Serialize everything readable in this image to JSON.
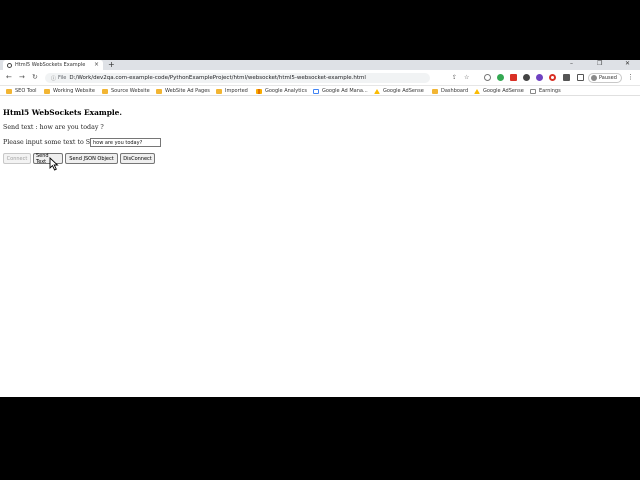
{
  "browser": {
    "tab_title": "Html5 WebSockets Example",
    "tab_close": "×",
    "new_tab": "+",
    "window_controls": [
      "–",
      "❐",
      "✕"
    ],
    "scheme": "File",
    "url": "D:/Work/dev2qa.com-example-code/PythonExampleProject/html/websocket/html5-websocket-example.html",
    "profile_label": "Paused"
  },
  "bookmarks": [
    {
      "label": "SEO Tool",
      "icon": "folder-icon"
    },
    {
      "label": "Working Website",
      "icon": "folder-icon"
    },
    {
      "label": "Source Website",
      "icon": "folder-icon"
    },
    {
      "label": "WebSite Ad Pages",
      "icon": "folder-icon"
    },
    {
      "label": "Imported",
      "icon": "folder-icon"
    },
    {
      "label": "Google Analytics",
      "icon": "analytics-icon"
    },
    {
      "label": "Google Ad Mana...",
      "icon": "google-icon"
    },
    {
      "label": "Google AdSense",
      "icon": "adsense-icon"
    },
    {
      "label": "Dashboard",
      "icon": "folder-icon"
    },
    {
      "label": "Google AdSense",
      "icon": "adsense-icon"
    },
    {
      "label": "Earnings",
      "icon": "earnings-icon"
    }
  ],
  "page": {
    "heading": "Html5 WebSockets Example.",
    "send_text": "Send text : how are you today ?",
    "prompt": "Please input some text to Send :",
    "input_value": "how are you today?",
    "buttons": {
      "connect": "Connect",
      "send_text": "Send Text",
      "send_json": "Send JSON Object",
      "disconnect": "DisConnect"
    }
  }
}
